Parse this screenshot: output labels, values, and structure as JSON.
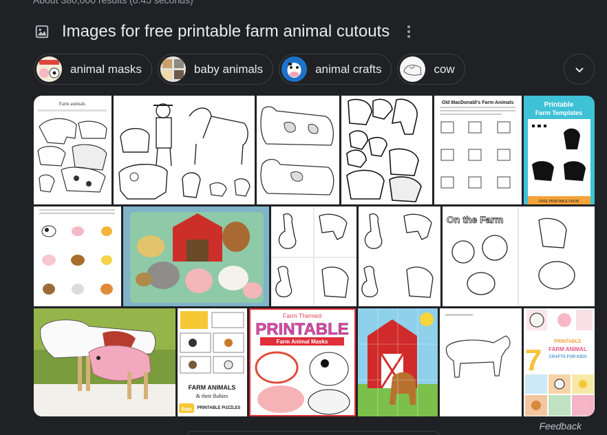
{
  "search": {
    "result_stats": "About 380,000 results (0.45 seconds)"
  },
  "images_section": {
    "title": "Images for free printable farm animal cutouts",
    "icon": "image-icon",
    "more_icon": "more-vert-icon"
  },
  "chips": [
    {
      "label": "animal masks",
      "thumb_color": "#e8e2d0"
    },
    {
      "label": "baby animals",
      "thumb_color": "#d7d4cc"
    },
    {
      "label": "animal crafts",
      "thumb_color": "#1e73c9"
    },
    {
      "label": "cow",
      "thumb_color": "#f4f4f4"
    }
  ],
  "expand_icon": "chevron-down-icon",
  "images": {
    "farm_animals_sheet": {
      "caption": "Farm animals"
    },
    "macdonald": {
      "caption": "Old MacDonald's Farm Animals"
    },
    "templates": {
      "title": "Printable",
      "subtitle": "Farm Templates",
      "footer": "FREE PRINTABLE FROM"
    },
    "on_the_farm": {
      "caption": "On the Farm"
    },
    "puzzles": {
      "line1": "FARM ANIMALS",
      "line2": "& their Babies",
      "line3": "PRINTABLE PUZZLES",
      "badge": "free"
    },
    "masks": {
      "top": "Farm Themed",
      "big": "PRINTABLE",
      "sub": "Farm Animal Masks"
    },
    "crafts": {
      "number": "7",
      "line1": "PRINTABLE",
      "line2": "FARM ANIMAL",
      "line3": "CRAFTS FOR KIDS"
    }
  },
  "feedback": "Feedback",
  "colors": {
    "background": "#202124",
    "chip_border": "#3c4043",
    "text": "#e8eaed",
    "muted": "#9aa0a6"
  }
}
